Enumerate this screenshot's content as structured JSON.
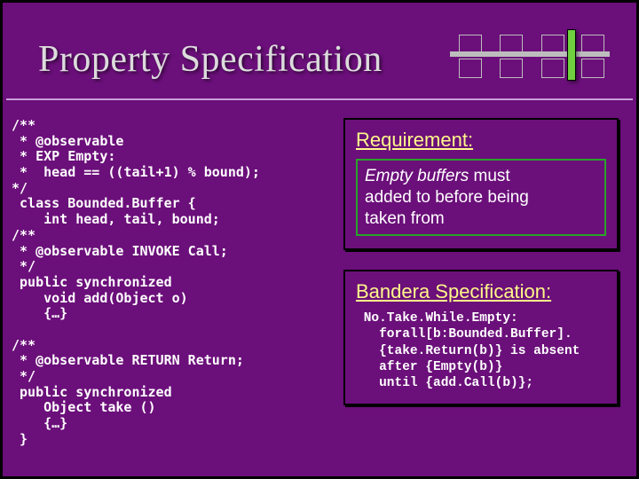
{
  "title": "Property Specification",
  "code": "/**\n * @observable\n * EXP Empty:\n *  head == ((tail+1) % bound);\n*/\n class Bounded.Buffer {\n    int head, tail, bound;\n/**\n * @observable INVOKE Call;\n */\n public synchronized\n    void add(Object o)\n    {…}\n\n/**\n * @observable RETURN Return;\n */\n public synchronized\n    Object take ()\n    {…}\n }",
  "requirement": {
    "heading": "Requirement:",
    "text_em": "Empty buffers",
    "text_rest1": " must",
    "text_line2": "added to before being",
    "text_line3": "taken from"
  },
  "bandera": {
    "heading": "Bandera Specification:",
    "body": " No.Take.While.Empty:\n   forall[b:Bounded.Buffer].\n   {take.Return(b)} is absent\n   after {Empty(b)}\n   until {add.Call(b)};"
  }
}
